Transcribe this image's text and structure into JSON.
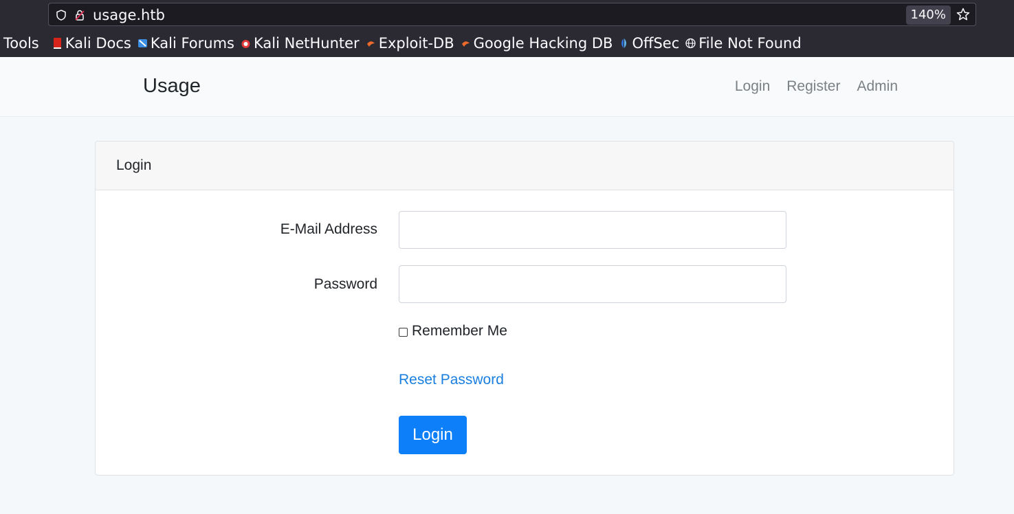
{
  "browser": {
    "url": "usage.htb",
    "zoom": "140%",
    "bookmarks": [
      {
        "label": "Tools",
        "icon": "none"
      },
      {
        "label": "Kali Docs",
        "icon": "kali-docs-icon"
      },
      {
        "label": "Kali Forums",
        "icon": "kali-forums-icon"
      },
      {
        "label": "Kali NetHunter",
        "icon": "nethunter-icon"
      },
      {
        "label": "Exploit-DB",
        "icon": "exploit-db-icon"
      },
      {
        "label": "Google Hacking DB",
        "icon": "ghdb-icon"
      },
      {
        "label": "OffSec",
        "icon": "offsec-icon"
      },
      {
        "label": "File Not Found",
        "icon": "globe-icon"
      }
    ]
  },
  "navbar": {
    "brand": "Usage",
    "links": [
      "Login",
      "Register",
      "Admin"
    ]
  },
  "card": {
    "title": "Login",
    "email_label": "E-Mail Address",
    "email_value": "",
    "password_label": "Password",
    "password_value": "",
    "remember_label": "Remember Me",
    "remember_checked": false,
    "reset_link": "Reset Password",
    "submit_label": "Login"
  },
  "colors": {
    "primary": "#0d7ff8",
    "link": "#1a7fe0",
    "chrome_bg": "#2b2a33"
  }
}
